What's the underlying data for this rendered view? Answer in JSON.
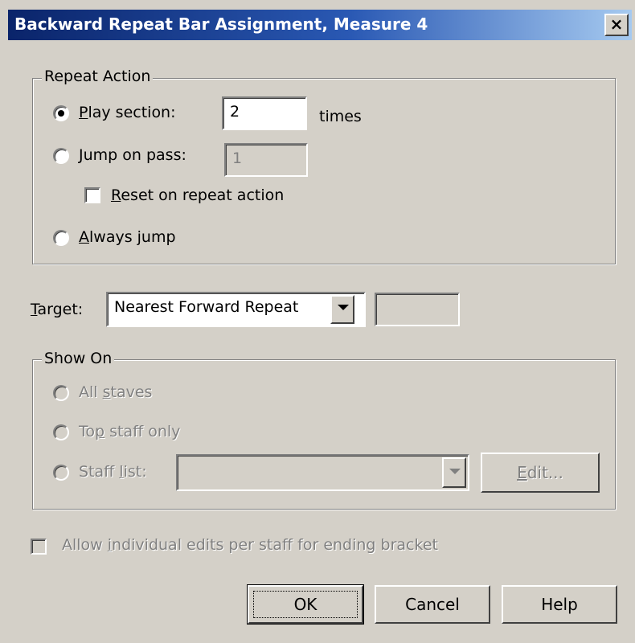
{
  "dialog": {
    "title": "Backward Repeat Bar Assignment, Measure 4",
    "close_label": "×"
  },
  "repeat_action": {
    "legend": "Repeat Action",
    "play_section": {
      "mnemonic": "P",
      "rest": "lay section:",
      "value": "2",
      "suffix": "times",
      "checked": true
    },
    "jump_on_pass": {
      "mnemonic": "J",
      "rest": "ump on pass:",
      "value": "1",
      "checked": false
    },
    "reset_on_repeat": {
      "mnemonic": "R",
      "rest": "eset on repeat action",
      "checked": false
    },
    "always_jump": {
      "mnemonic": "A",
      "rest": "lways jump",
      "checked": false
    }
  },
  "target": {
    "label_mnemonic": "T",
    "label_rest": "arget:",
    "selected": "Nearest Forward Repeat",
    "extra_value": ""
  },
  "show_on": {
    "legend": "Show On",
    "all_staves": {
      "prefix": "All ",
      "mnemonic": "s",
      "rest": "taves"
    },
    "top_staff_only": {
      "prefix": "To",
      "mnemonic": "p",
      "rest": " staff only"
    },
    "staff_list": {
      "prefix": "Staff ",
      "mnemonic": "l",
      "rest": "ist:",
      "value": ""
    },
    "edit_button": {
      "mnemonic": "E",
      "rest": "dit..."
    }
  },
  "allow_individual_edits": {
    "prefix": "Allow ",
    "mnemonic": "i",
    "rest": "ndividual edits per staff for ending bracket",
    "checked": false
  },
  "buttons": {
    "ok": "OK",
    "cancel": "Cancel",
    "help": "Help"
  }
}
